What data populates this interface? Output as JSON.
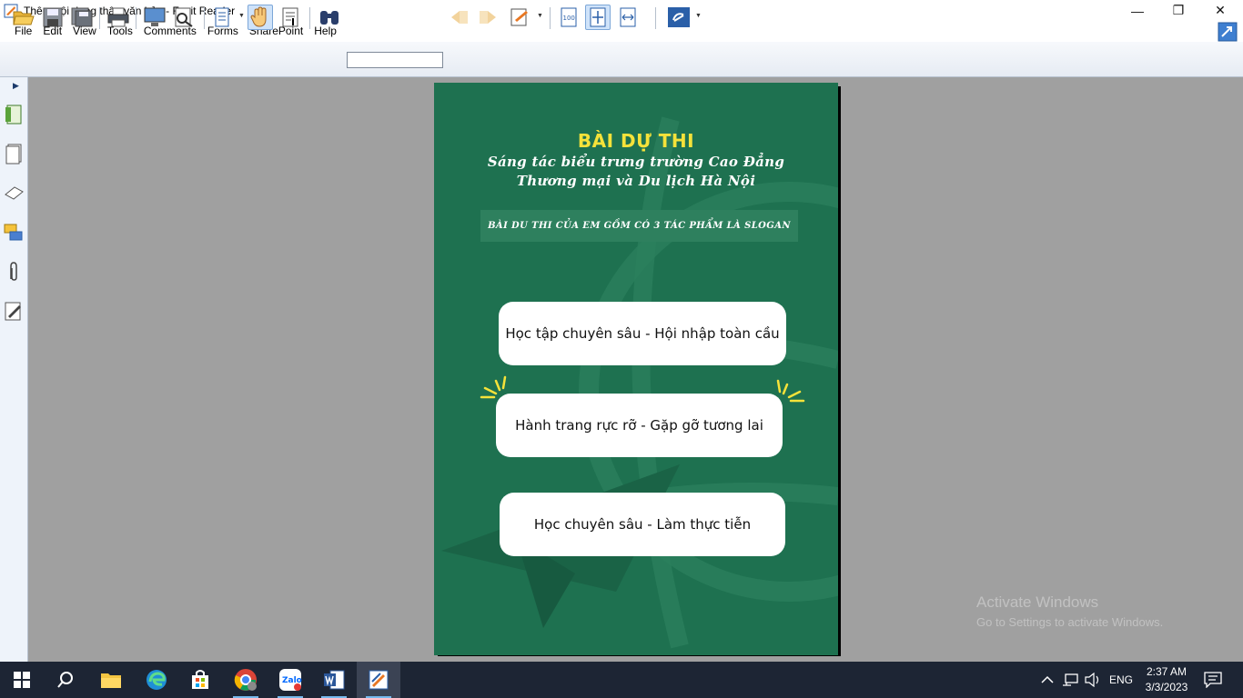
{
  "window": {
    "title": "Thêm nội dung thân văn bản - Foxit Reader",
    "minimize": "—",
    "restore": "❐",
    "close": "✕"
  },
  "menu": [
    "File",
    "Edit",
    "View",
    "Tools",
    "Comments",
    "Forms",
    "SharePoint",
    "Help"
  ],
  "toolbar": {
    "search_value": "",
    "zoom_label": "100"
  },
  "document": {
    "title": "BÀI DỰ THI",
    "subtitle_line1": "Sáng tác biểu trưng trường Cao Đẳng",
    "subtitle_line2": "Thương mại và Du lịch Hà Nội",
    "banner": "BÀI DU THI CỦA EM GỒM CÓ 3 TÁC PHẨM LÀ SLOGAN",
    "slogans": [
      "Học tập chuyên sâu - Hội nhập toàn cầu",
      "Hành trang rực rỡ - Gặp gỡ tương lai",
      "Học chuyên sâu - Làm thực tiễn"
    ]
  },
  "watermark": {
    "line1": "Activate Windows",
    "line2": "Go to Settings to activate Windows."
  },
  "taskbar": {
    "apps": [
      "start-icon",
      "search-icon",
      "file-explorer-icon",
      "edge-icon",
      "store-icon",
      "chrome-icon",
      "zalo-icon",
      "word-icon",
      "foxit-reader-icon"
    ],
    "zalo_label": "Zalo",
    "language": "ENG",
    "time": "2:37 AM",
    "date": "3/3/2023"
  },
  "colors": {
    "page_green": "#1e7150",
    "title_yellow": "#f5e23a",
    "taskbar": "#1d2534"
  }
}
